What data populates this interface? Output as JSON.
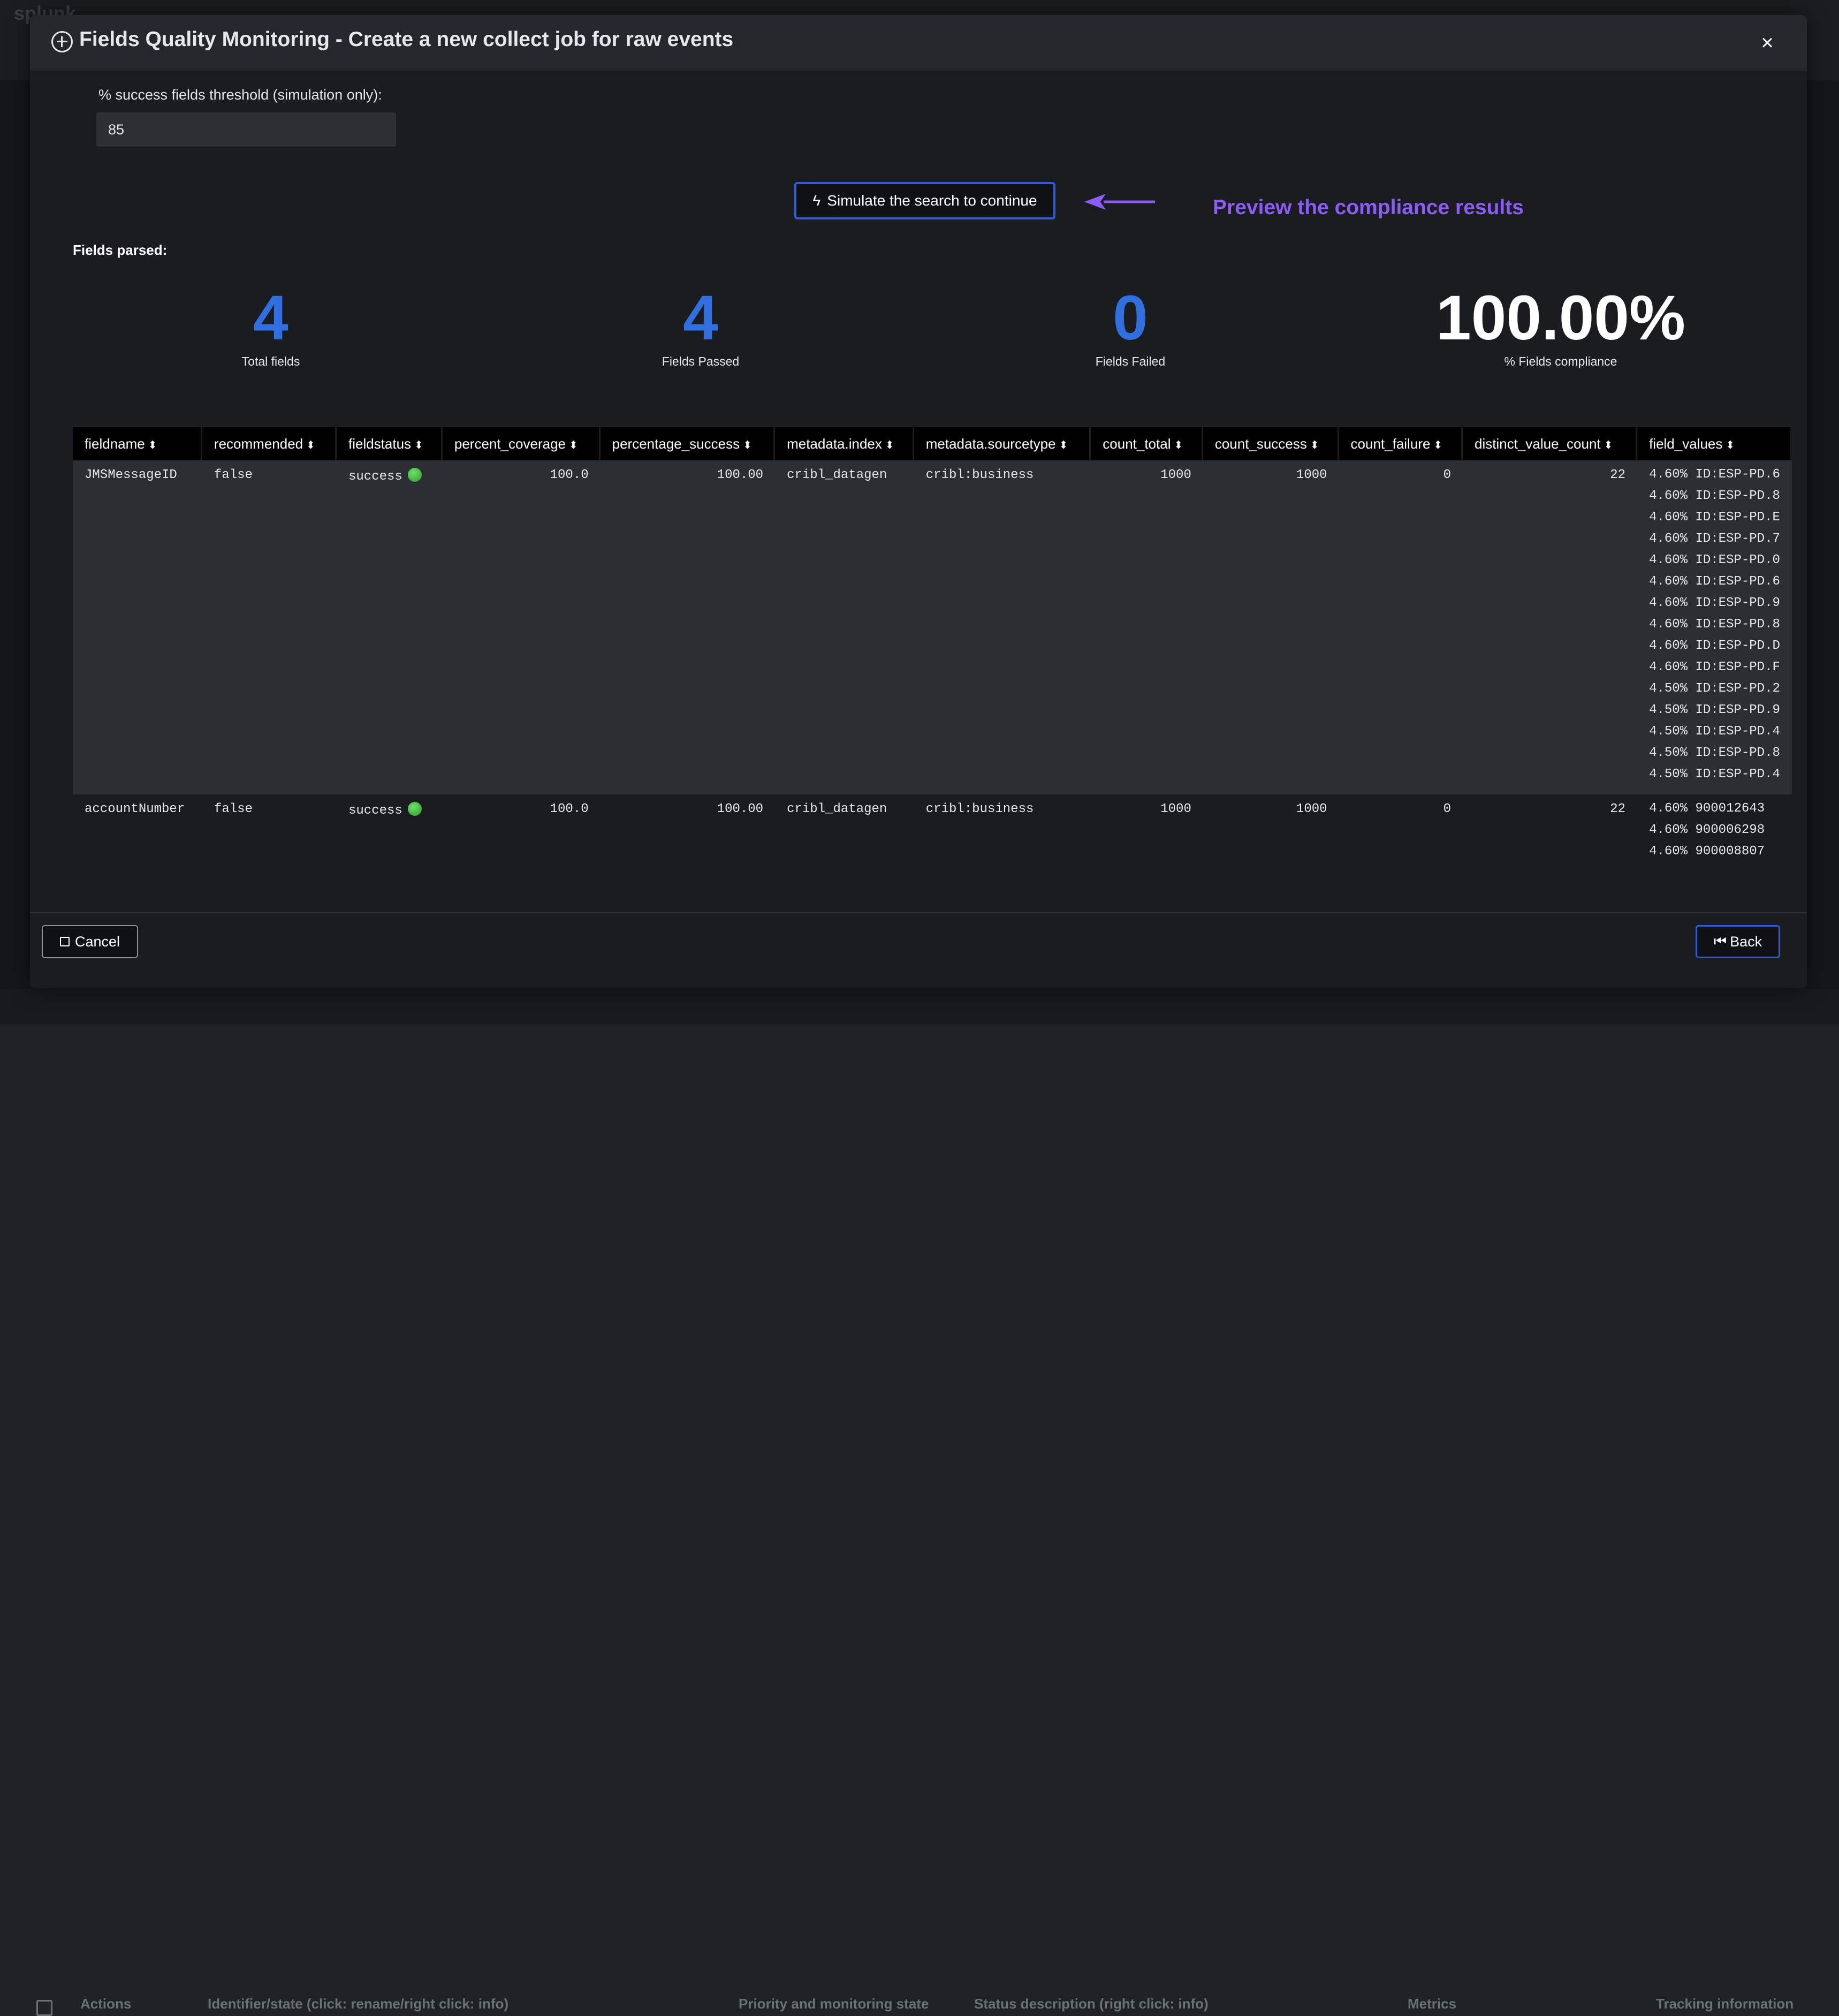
{
  "modal": {
    "title": "Fields Quality Monitoring - Create a new collect job for raw events",
    "close_symbol": "×"
  },
  "threshold": {
    "label": "% success fields threshold (simulation only):",
    "value": "85"
  },
  "simulate": {
    "label": "Simulate the search to continue",
    "annotation": "Preview the compliance results",
    "annotation_color": "#8b5cf6"
  },
  "fields_parsed_label": "Fields parsed:",
  "stats": [
    {
      "value": "4",
      "label": "Total fields",
      "color": "#2f6fe0"
    },
    {
      "value": "4",
      "label": "Fields Passed",
      "color": "#2f6fe0"
    },
    {
      "value": "0",
      "label": "Fields Failed",
      "color": "#2f6fe0"
    },
    {
      "value": "100.00%",
      "label": "% Fields compliance",
      "color": "#ffffff"
    }
  ],
  "table": {
    "columns": [
      "fieldname",
      "recommended",
      "fieldstatus",
      "percent_coverage",
      "percentage_success",
      "metadata.index",
      "metadata.sourcetype",
      "count_total",
      "count_success",
      "count_failure",
      "distinct_value_count",
      "field_values"
    ],
    "rows": [
      {
        "fieldname": "JMSMessageID",
        "recommended": "false",
        "fieldstatus": "success",
        "percent_coverage": "100.0",
        "percentage_success": "100.00",
        "metadata_index": "cribl_datagen",
        "metadata_sourcetype": "cribl:business",
        "count_total": "1000",
        "count_success": "1000",
        "count_failure": "0",
        "distinct_value_count": "22",
        "field_values": [
          "4.60% ID:ESP-PD.6",
          "4.60% ID:ESP-PD.8",
          "4.60% ID:ESP-PD.E",
          "4.60% ID:ESP-PD.7",
          "4.60% ID:ESP-PD.0",
          "4.60% ID:ESP-PD.6",
          "4.60% ID:ESP-PD.9",
          "4.60% ID:ESP-PD.8",
          "4.60% ID:ESP-PD.D",
          "4.60% ID:ESP-PD.F",
          "4.50% ID:ESP-PD.2",
          "4.50% ID:ESP-PD.9",
          "4.50% ID:ESP-PD.4",
          "4.50% ID:ESP-PD.8",
          "4.50% ID:ESP-PD.4"
        ]
      },
      {
        "fieldname": "accountNumber",
        "recommended": "false",
        "fieldstatus": "success",
        "percent_coverage": "100.0",
        "percentage_success": "100.00",
        "metadata_index": "cribl_datagen",
        "metadata_sourcetype": "cribl:business",
        "count_total": "1000",
        "count_success": "1000",
        "count_failure": "0",
        "distinct_value_count": "22",
        "field_values": [
          "4.60% 900012643",
          "4.60% 900006298",
          "4.60% 900008807"
        ]
      }
    ]
  },
  "footer": {
    "cancel_label": "Cancel",
    "back_label": "Back"
  },
  "background": {
    "logo": "splunk",
    "columns": [
      "Actions",
      "Identifier/state (click: rename/right click: info)",
      "Priority and monitoring state",
      "Status description (right click: info)",
      "Metrics",
      "Tracking information"
    ]
  }
}
